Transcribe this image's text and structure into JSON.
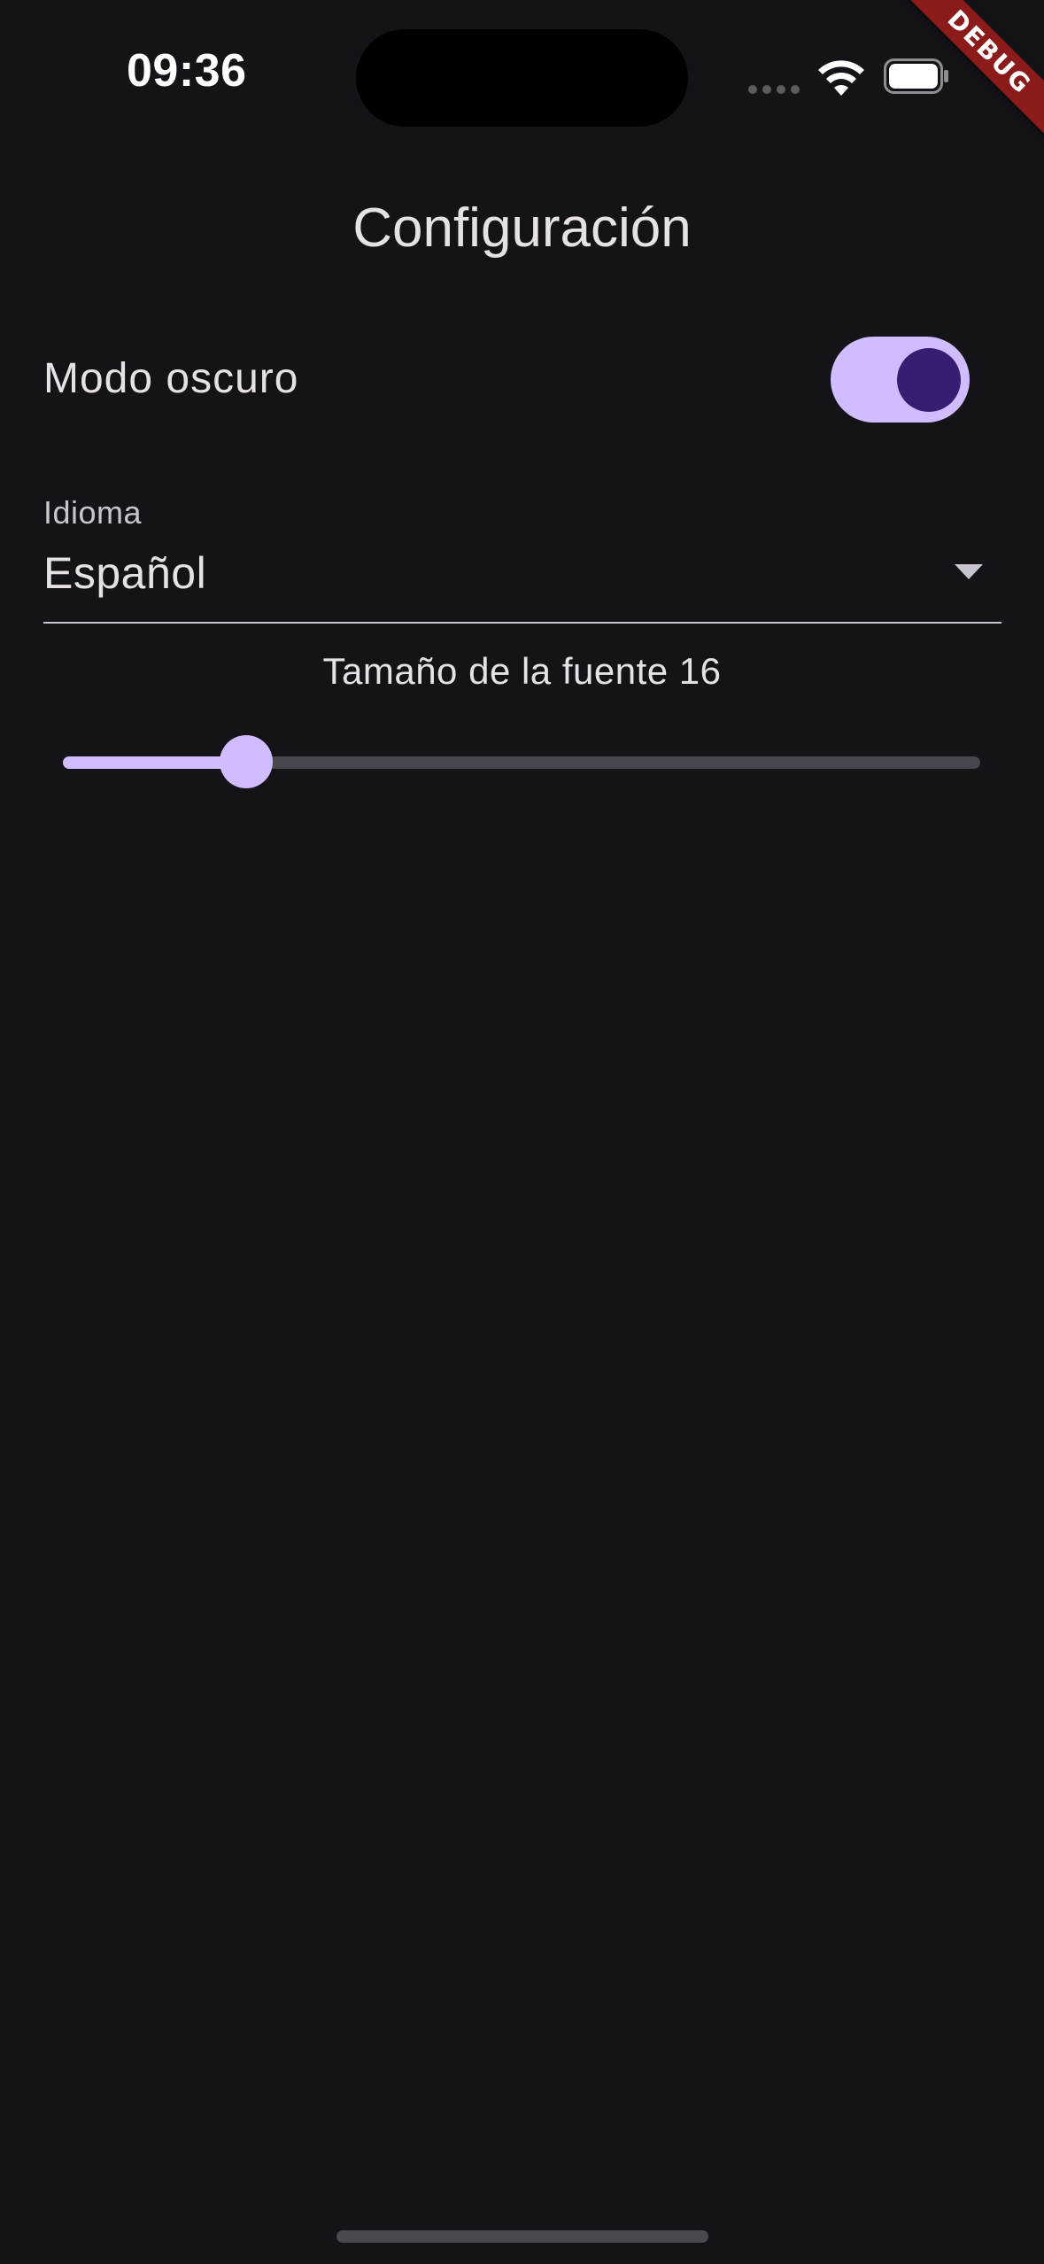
{
  "status_bar": {
    "time": "09:36"
  },
  "debug_banner": "DEBUG",
  "page": {
    "title": "Configuración"
  },
  "dark_mode": {
    "label": "Modo oscuro",
    "enabled": true
  },
  "language": {
    "label": "Idioma",
    "selected": "Español"
  },
  "font_size": {
    "label": "Tamaño de la fuente 16",
    "value_fraction": 0.2
  },
  "colors": {
    "background": "#141318",
    "accent": "#d0bcff",
    "accent_dark": "#381e72",
    "debug": "#8b1a1a"
  }
}
